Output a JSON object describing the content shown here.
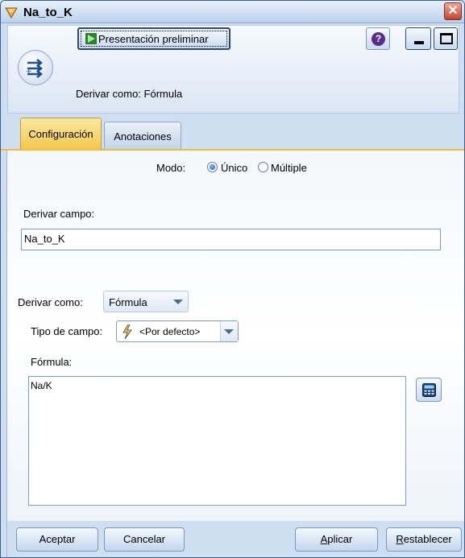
{
  "window": {
    "title": "Na_to_K",
    "close_glyph": "✕"
  },
  "header": {
    "preview_label": "Presentación preliminar",
    "help_glyph": "?",
    "derive_as_text": "Derivar como: Fórmula"
  },
  "tabs": [
    {
      "label": "Configuración",
      "active": true
    },
    {
      "label": "Anotaciones",
      "active": false
    }
  ],
  "settings": {
    "mode_label": "Modo:",
    "mode_options": [
      {
        "label": "Único",
        "checked": true
      },
      {
        "label": "Múltiple",
        "checked": false
      }
    ],
    "derive_field_label": "Derivar campo:",
    "derive_field_value": "Na_to_K",
    "derive_as_label": "Derivar como:",
    "derive_as_value": "Fórmula",
    "field_type_label": "Tipo de campo:",
    "field_type_value": "<Por defecto>",
    "formula_label": "Fórmula:",
    "formula_value": "Na/K"
  },
  "footer": {
    "ok_label": "Aceptar",
    "cancel_label": "Cancelar",
    "apply_label": "Aplicar",
    "reset_label": "Restablecer"
  },
  "colors": {
    "active_tab": "#f5c64a",
    "window_bg": "#cfdef0",
    "close_button": "#c6442b"
  },
  "icons": [
    "app-icon",
    "close-icon",
    "derive-node-icon",
    "play-icon",
    "help-icon",
    "minimize-icon",
    "maximize-icon",
    "lightning-icon",
    "chevron-down-icon",
    "calculator-icon"
  ]
}
